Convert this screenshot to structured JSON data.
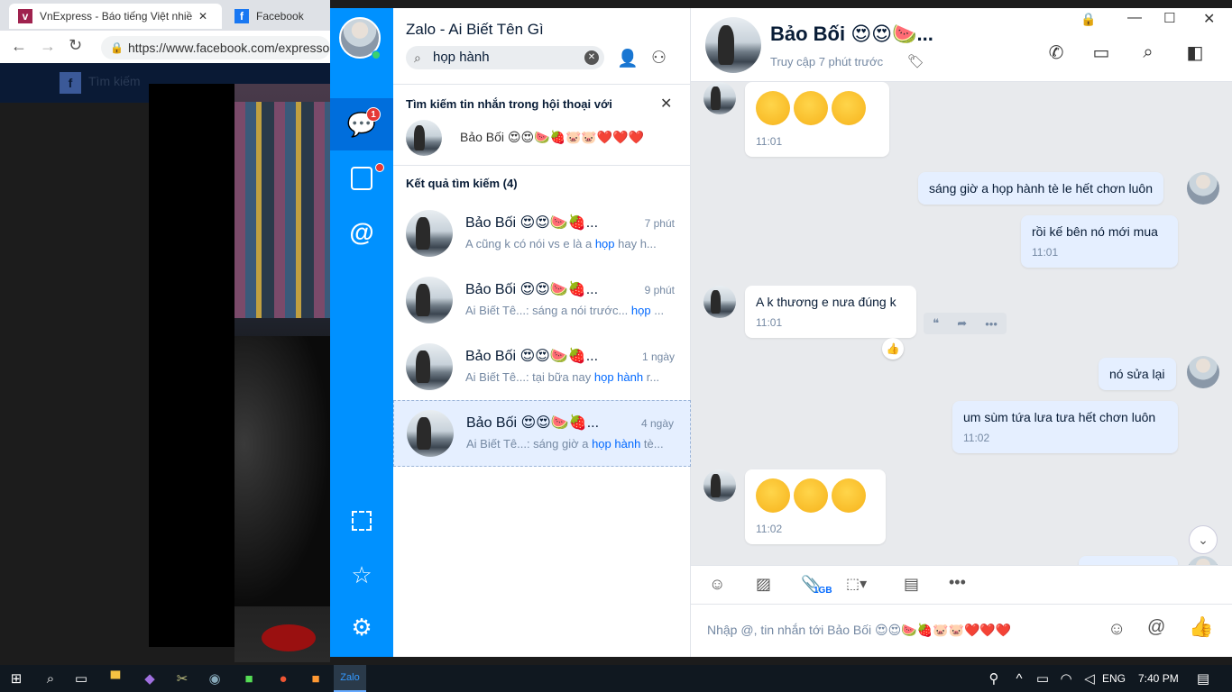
{
  "browser": {
    "tabs": [
      {
        "title": "VnExpress - Báo tiếng Việt nhiều",
        "icon": "vnexpress-icon"
      },
      {
        "title": "Facebook",
        "icon": "facebook-icon"
      }
    ],
    "url": "https://www.facebook.com/expresso",
    "fb_search_placeholder": "Tìm kiếm"
  },
  "zalo": {
    "window_title": "Zalo - Ai Biết Tên Gì",
    "search_value": "họp hành",
    "nav": {
      "messages_badge": "1"
    },
    "search_in_conv_label": "Tìm kiếm tin nhắn trong hội thoại với",
    "search_in_conv_name": "Bảo Bối 😍😍🍉🍓🐷🐷❤️❤️❤️",
    "results_label": "Kết quả tìm kiếm (4)",
    "results": [
      {
        "name": "Bảo Bối 😍😍🍉🍓...",
        "time": "7 phút",
        "prev_a": "A cũng k có nói vs e là a ",
        "prev_hl": "họp",
        "prev_b": " hay h..."
      },
      {
        "name": "Bảo Bối 😍😍🍉🍓...",
        "time": "9 phút",
        "prev_a": "Ai Biết Tê...: sáng a nói trước... ",
        "prev_hl": "họp",
        "prev_b": " ..."
      },
      {
        "name": "Bảo Bối 😍😍🍉🍓...",
        "time": "1 ngày",
        "prev_a": "Ai Biết Tê...: tại bữa nay ",
        "prev_hl": "họp hành",
        "prev_b": " r..."
      },
      {
        "name": "Bảo Bối 😍😍🍉🍓...",
        "time": "4 ngày",
        "prev_a": "Ai Biết Tê...: sáng giờ a ",
        "prev_hl": "họp hành",
        "prev_b": " tè..."
      }
    ],
    "chat": {
      "name": "Bảo Bối 😍😍🍉...",
      "status": "Truy cập 7 phút trước",
      "messages": [
        {
          "text": "",
          "time": "11:01"
        },
        {
          "text": "sáng giờ a họp hành tè le hết chơn luôn",
          "time": ""
        },
        {
          "text": "rồi kế bên nó mới mua",
          "time": "11:01"
        },
        {
          "text": "A k thương e nưa đúng k",
          "time": "11:01"
        },
        {
          "text": "nó sửa lại",
          "time": ""
        },
        {
          "text": "um sùm tứa lưa tưa hết chơn luôn",
          "time": "11:02"
        },
        {
          "text": "",
          "time": "11:02"
        }
      ],
      "file_size_label": "1GB",
      "input_placeholder": "Nhập @, tin nhắn tới Bảo Bối 😍😍🍉🍓🐷🐷❤️❤️❤️"
    }
  },
  "taskbar": {
    "lang": "ENG",
    "time": "7:40 PM"
  }
}
